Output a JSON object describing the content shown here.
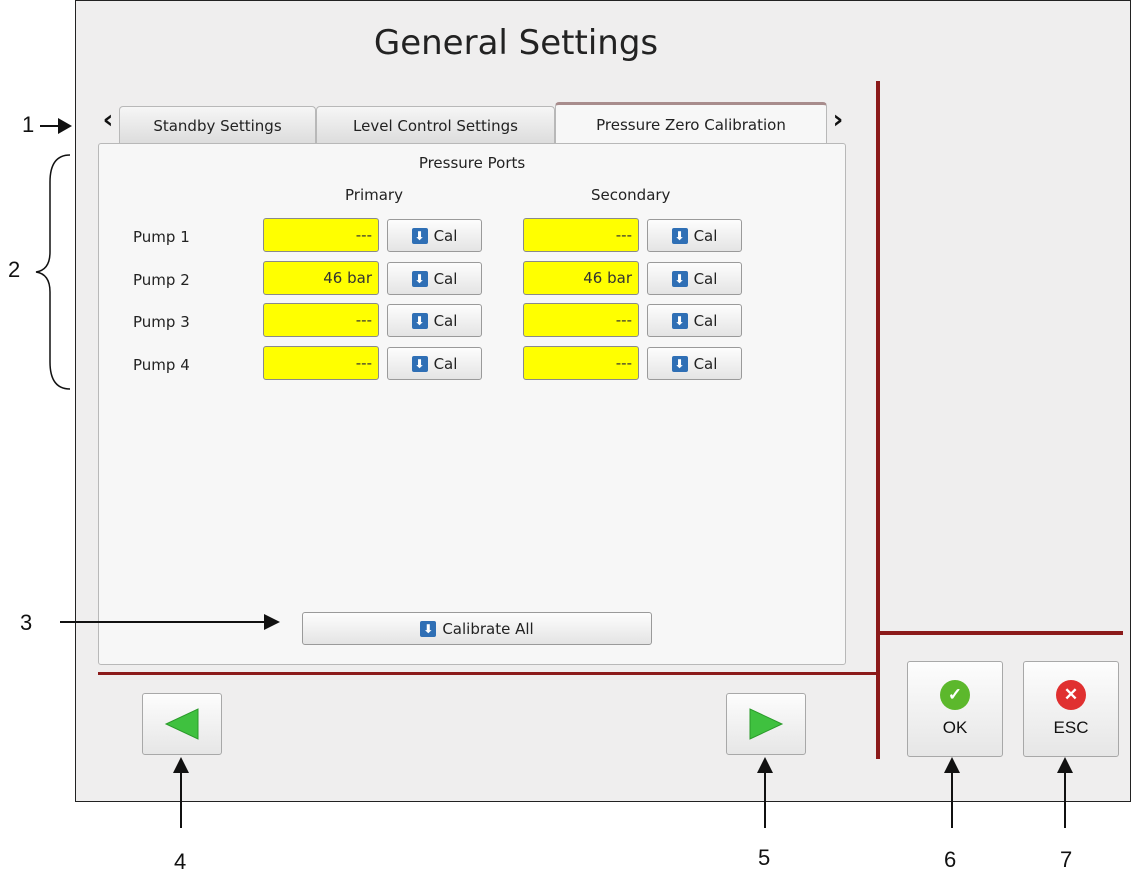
{
  "title": "General Settings",
  "tabs": [
    {
      "label": "Standby Settings",
      "active": false
    },
    {
      "label": "Level Control Settings",
      "active": false
    },
    {
      "label": "Pressure Zero Calibration",
      "active": true
    }
  ],
  "panel": {
    "section_title": "Pressure Ports",
    "col_primary": "Primary",
    "col_secondary": "Secondary",
    "pumps": [
      {
        "label": "Pump 1",
        "primary": "---",
        "secondary": "---"
      },
      {
        "label": "Pump 2",
        "primary": "46 bar",
        "secondary": "46 bar"
      },
      {
        "label": "Pump 3",
        "primary": "---",
        "secondary": "---"
      },
      {
        "label": "Pump 4",
        "primary": "---",
        "secondary": "---"
      }
    ],
    "cal_label": "Cal",
    "calibrate_all_label": "Calibrate All"
  },
  "buttons": {
    "ok": "OK",
    "esc": "ESC"
  },
  "callouts": [
    "1",
    "2",
    "3",
    "4",
    "5",
    "6",
    "7"
  ],
  "colors": {
    "field": "#ffff00",
    "divider": "#8b1a1a",
    "ok_green": "#5cb82c",
    "esc_red": "#e03030",
    "icon_blue": "#2f6fb5",
    "nav_green": "#3fc13f"
  }
}
